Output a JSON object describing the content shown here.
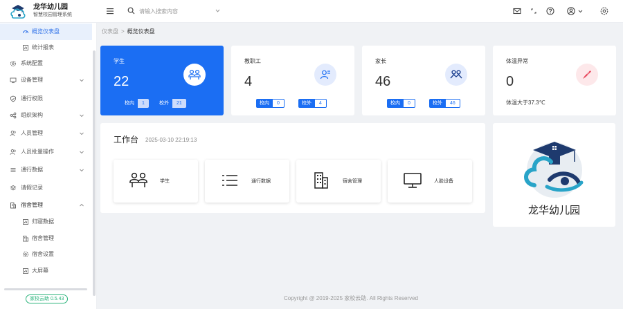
{
  "brand": {
    "title": "龙华幼儿园",
    "subtitle": "智慧校园管理系统"
  },
  "search": {
    "placeholder": "请输入搜索内容"
  },
  "header_icons": [
    "mail-icon",
    "fullscreen-icon",
    "help-icon",
    "user-icon",
    "settings-icon"
  ],
  "sidebar": {
    "items": [
      {
        "label": "概览仪表盘",
        "icon": "dashboard-icon",
        "active": true,
        "sub": true
      },
      {
        "label": "统计报表",
        "icon": "report-icon",
        "sub": true
      },
      {
        "label": "系统配置",
        "icon": "gear-icon"
      },
      {
        "label": "设备管理",
        "icon": "monitor-icon",
        "expandable": true
      },
      {
        "label": "通行权限",
        "icon": "shield-icon"
      },
      {
        "label": "组织架构",
        "icon": "org-icon",
        "expandable": true
      },
      {
        "label": "人员管理",
        "icon": "people-icon",
        "expandable": true
      },
      {
        "label": "人员批量操作",
        "icon": "people-batch-icon",
        "expandable": true
      },
      {
        "label": "通行数据",
        "icon": "list-icon",
        "expandable": true
      },
      {
        "label": "请假记录",
        "icon": "leave-icon"
      },
      {
        "label": "宿舍管理",
        "icon": "building-icon",
        "expanded": true
      },
      {
        "label": "归寝数据",
        "icon": "data-icon",
        "sub": true
      },
      {
        "label": "宿舍管理",
        "icon": "building-icon",
        "sub": true
      },
      {
        "label": "宿舍设置",
        "icon": "gear-icon",
        "sub": true
      },
      {
        "label": "大屏幕",
        "icon": "screen-icon",
        "sub": true
      }
    ],
    "version": "家校云助 0.5.43"
  },
  "breadcrumb": {
    "root": "仪表盘",
    "sep": ">",
    "current": "概览仪表盘"
  },
  "stats": [
    {
      "label": "学生",
      "value": "22",
      "inner_label": "校内",
      "inner": "1",
      "outer_label": "校外",
      "outer": "21",
      "icon": "student-icon",
      "icon_bg": "#ffffff",
      "icon_color": "#1b6ef3"
    },
    {
      "label": "教职工",
      "value": "4",
      "inner_label": "校内",
      "inner": "0",
      "outer_label": "校外",
      "outer": "4",
      "icon": "staff-icon",
      "icon_bg": "#e3ebfd",
      "icon_color": "#1b6ef3"
    },
    {
      "label": "家长",
      "value": "46",
      "inner_label": "校内",
      "inner": "0",
      "outer_label": "校外",
      "outer": "46",
      "icon": "parent-icon",
      "icon_bg": "#e3ebfd",
      "icon_color": "#1b3f8f"
    },
    {
      "label": "体温异常",
      "value": "0",
      "note": "体温大于37.3℃",
      "icon": "thermometer-icon",
      "icon_bg": "#fde8ea",
      "icon_color": "#e8455a"
    }
  ],
  "workbench": {
    "title": "工作台",
    "time": "2025-03-10 22:19:13",
    "shortcuts": [
      {
        "label": "学生",
        "icon": "student-icon"
      },
      {
        "label": "通行数据",
        "icon": "list-icon"
      },
      {
        "label": "宿舍管理",
        "icon": "building-icon"
      },
      {
        "label": "人脸设备",
        "icon": "monitor-icon"
      }
    ]
  },
  "logo_card": {
    "name": "龙华幼儿园"
  },
  "footer": "Copyright @ 2019-2025 家校云助. All Rights Reserved",
  "colors": {
    "primary": "#1b6ef3",
    "success": "#29b37a",
    "danger": "#e8455a"
  }
}
